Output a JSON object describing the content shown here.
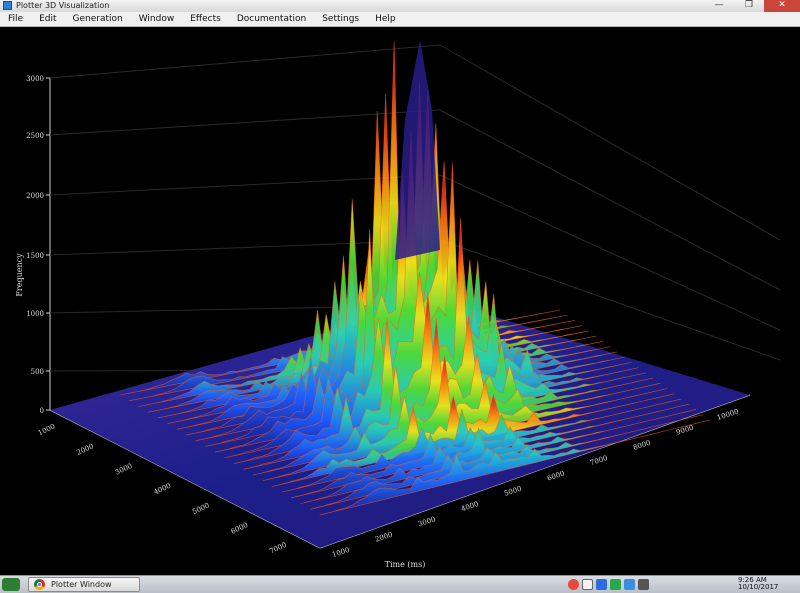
{
  "window": {
    "title": "Plotter 3D Visualization"
  },
  "window_buttons": [
    "—",
    "❐",
    "✕"
  ],
  "menu": [
    "File",
    "Edit",
    "Generation",
    "Window",
    "Effects",
    "Documentation",
    "Settings",
    "Help"
  ],
  "plot": {
    "z_axis_ticks": [
      "3000",
      "2500",
      "2000",
      "1500",
      "1000",
      "500",
      "0"
    ],
    "z_axis_label": "Frequency",
    "left_axis_ticks": [
      "1000",
      "2000",
      "3000",
      "4000",
      "5000",
      "6000",
      "7000"
    ],
    "right_axis_ticks": [
      "1000",
      "2000",
      "3000",
      "4000",
      "5000",
      "6000",
      "7000",
      "8000",
      "9000",
      "10000"
    ],
    "bottom_label": "Time (ms)",
    "colors": {
      "low": "#1b1b8f",
      "mid_blue": "#1e6bff",
      "green": "#3ad43a",
      "yellow": "#f4e21c",
      "orange": "#ff7a10",
      "red": "#e8231c",
      "peak": "#3a1a9a"
    }
  },
  "taskbar": {
    "app_label": "Plotter Window",
    "tray_icons": [
      "chrome-icon",
      "security-icon",
      "network-icon",
      "update-icon",
      "app-icon",
      "volume-icon"
    ],
    "clock_time": "9:26 AM",
    "clock_date": "10/10/2017"
  }
}
